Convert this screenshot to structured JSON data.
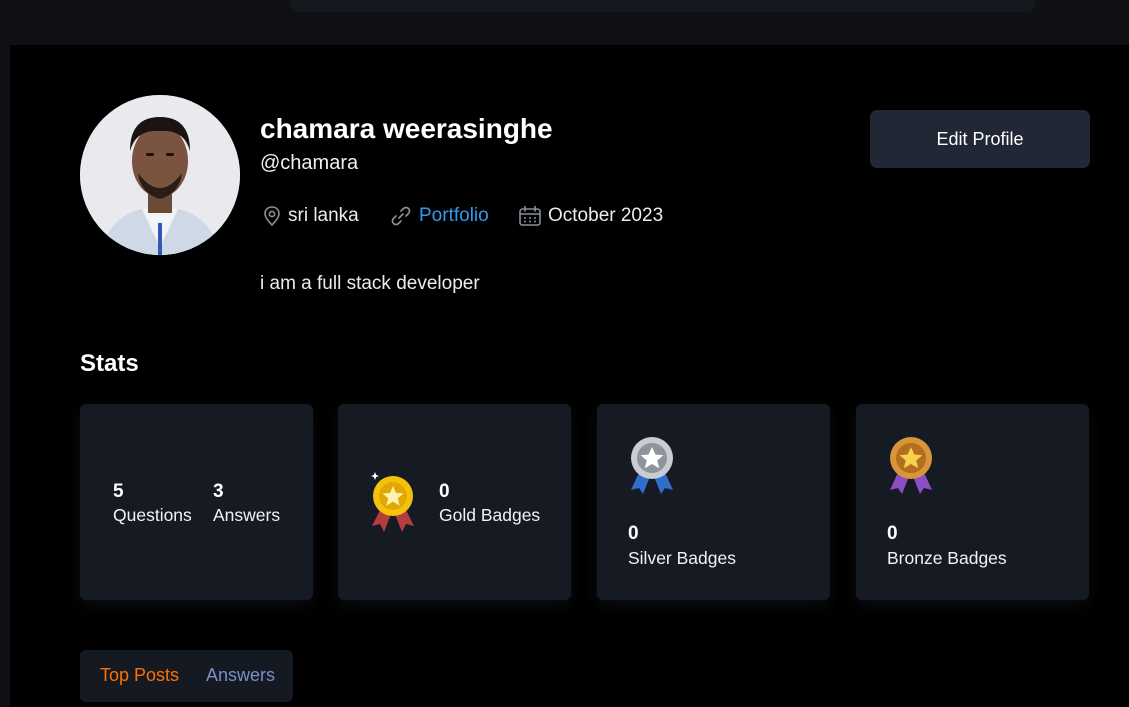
{
  "profile": {
    "name": "chamara weerasinghe",
    "username": "@chamara",
    "location": "sri lanka",
    "portfolio_label": "Portfolio",
    "joined": "October 2023",
    "bio": "i am a full stack developer",
    "edit_button": "Edit Profile"
  },
  "stats": {
    "title": "Stats",
    "questions": {
      "value": "5",
      "label": "Questions"
    },
    "answers": {
      "value": "3",
      "label": "Answers"
    },
    "gold": {
      "value": "0",
      "label": "Gold Badges",
      "icon": "gold-medal-icon"
    },
    "silver": {
      "value": "0",
      "label": "Silver Badges",
      "icon": "silver-medal-icon"
    },
    "bronze": {
      "value": "0",
      "label": "Bronze Badges",
      "icon": "bronze-medal-icon"
    }
  },
  "tabs": [
    {
      "label": "Top Posts",
      "active": true
    },
    {
      "label": "Answers",
      "active": false
    }
  ],
  "colors": {
    "accent": "#ff7000",
    "link": "#2f9bf0",
    "card_bg": "#161a22",
    "button_bg": "#212734"
  }
}
